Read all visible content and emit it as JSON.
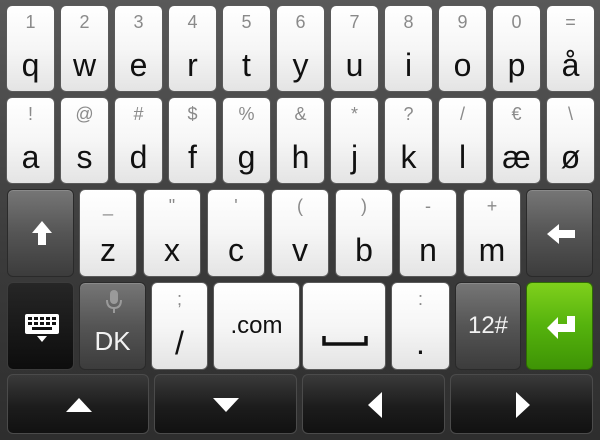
{
  "keyboard": {
    "row1": [
      {
        "alt": "1",
        "main": "q"
      },
      {
        "alt": "2",
        "main": "w"
      },
      {
        "alt": "3",
        "main": "e"
      },
      {
        "alt": "4",
        "main": "r"
      },
      {
        "alt": "5",
        "main": "t"
      },
      {
        "alt": "6",
        "main": "y"
      },
      {
        "alt": "7",
        "main": "u"
      },
      {
        "alt": "8",
        "main": "i"
      },
      {
        "alt": "9",
        "main": "o"
      },
      {
        "alt": "0",
        "main": "p"
      },
      {
        "alt": "=",
        "main": "å"
      }
    ],
    "row2": [
      {
        "alt": "!",
        "main": "a"
      },
      {
        "alt": "@",
        "main": "s"
      },
      {
        "alt": "#",
        "main": "d"
      },
      {
        "alt": "$",
        "main": "f"
      },
      {
        "alt": "%",
        "main": "g"
      },
      {
        "alt": "&",
        "main": "h"
      },
      {
        "alt": "*",
        "main": "j"
      },
      {
        "alt": "?",
        "main": "k"
      },
      {
        "alt": "/",
        "main": "l"
      },
      {
        "alt": "€",
        "main": "æ"
      },
      {
        "alt": "\\",
        "main": "ø"
      }
    ],
    "row3": [
      {
        "alt": "_",
        "main": "z"
      },
      {
        "alt": "\"",
        "main": "x"
      },
      {
        "alt": "'",
        "main": "c"
      },
      {
        "alt": "(",
        "main": "v"
      },
      {
        "alt": ")",
        "main": "b"
      },
      {
        "alt": "-",
        "main": "n"
      },
      {
        "alt": "+",
        "main": "m"
      }
    ],
    "row4": {
      "lang_label": "DK",
      "slash": {
        "alt": ";",
        "main": "/"
      },
      "dotcom_label": ".com",
      "period": {
        "alt": ":",
        "main": "."
      },
      "symbols_label": "12#"
    },
    "icons": {
      "shift": "arrow-up-icon",
      "backspace": "arrow-left-icon",
      "keyboard": "keyboard-hide-icon",
      "mic": "microphone-icon",
      "space": "space-bar-icon",
      "enter": "enter-icon",
      "nav_up": "triangle-up-icon",
      "nav_down": "triangle-down-icon",
      "nav_left": "triangle-left-icon",
      "nav_right": "triangle-right-icon"
    },
    "colors": {
      "enter_key": "#55b20d",
      "light_key": "#f6f6f6",
      "dark_key": "#555555"
    }
  }
}
